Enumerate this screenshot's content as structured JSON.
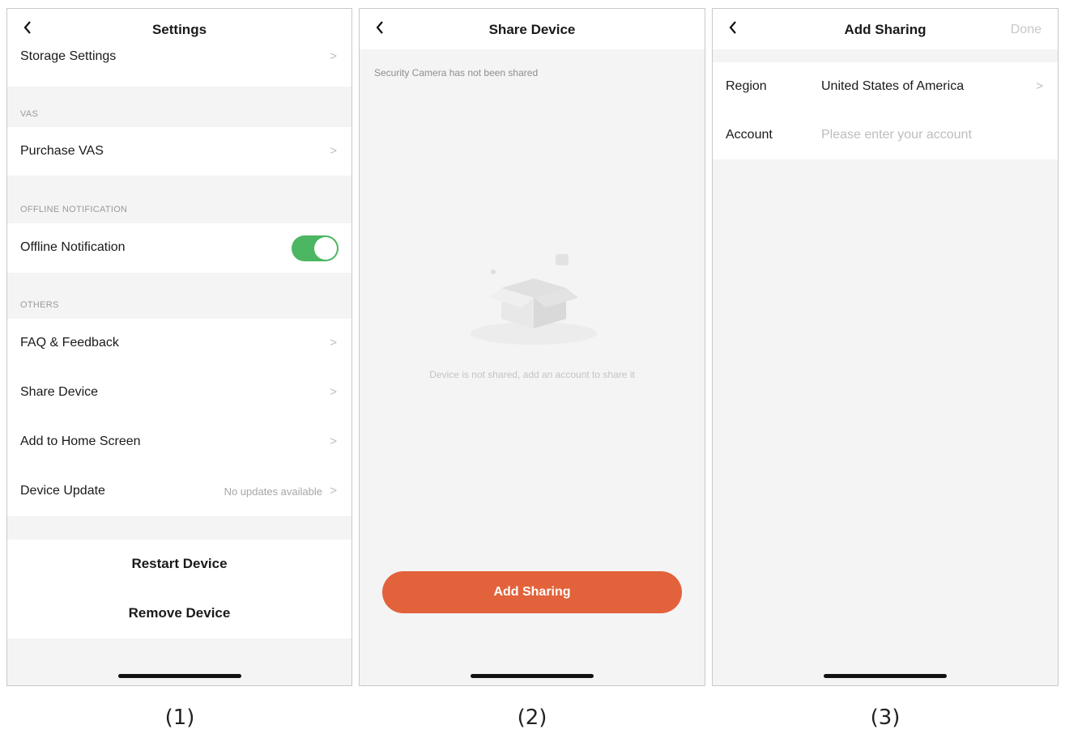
{
  "screen1": {
    "title": "Settings",
    "storage": "Storage Settings",
    "vas_header": "VAS",
    "purchase_vas": "Purchase VAS",
    "offline_header": "OFFLINE NOTIFICATION",
    "offline_label": "Offline Notification",
    "offline_enabled": true,
    "others_header": "OTHERS",
    "faq": "FAQ & Feedback",
    "share": "Share Device",
    "home_screen": "Add to Home Screen",
    "update": "Device Update",
    "update_status": "No updates available",
    "restart": "Restart Device",
    "remove": "Remove Device",
    "caption": "(1)"
  },
  "screen2": {
    "title": "Share Device",
    "info": "Security Camera has not been shared",
    "empty": "Device is not shared, add an account to share it",
    "button": "Add Sharing",
    "caption": "(2)"
  },
  "screen3": {
    "title": "Add Sharing",
    "done": "Done",
    "region_label": "Region",
    "region_value": "United States of America",
    "account_label": "Account",
    "account_placeholder": "Please enter your account",
    "caption": "(3)"
  },
  "icons": {
    "back": "back-chevron-icon",
    "chevron": "chevron-right-icon",
    "empty": "empty-box-icon"
  },
  "colors": {
    "accent": "#e2623b",
    "toggle_on": "#4cb662"
  }
}
